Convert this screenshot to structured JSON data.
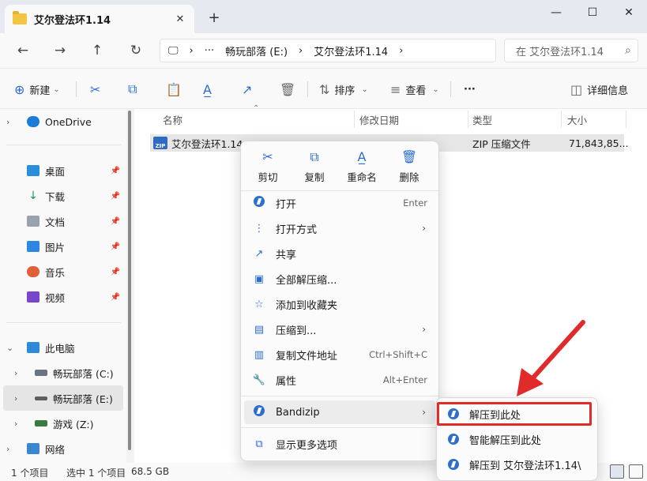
{
  "window": {
    "tab_title": "艾尔登法环1.14",
    "tab_close": "✕",
    "new_tab": "+",
    "minimize": "—",
    "maximize": "☐",
    "close": "✕"
  },
  "nav": {
    "back": "←",
    "forward": "→",
    "up": "↑",
    "refresh": "↻"
  },
  "address": {
    "computer_icon": "🖵",
    "sep1": "›",
    "more": "···",
    "crumb1": "畅玩部落 (E:)",
    "sep2": "›",
    "crumb2": "艾尔登法环1.14",
    "sep3": "›"
  },
  "search": {
    "placeholder": "在 艾尔登法环1.14",
    "icon": "⌕"
  },
  "toolbar": {
    "new_icon": "⊕",
    "new_label": "新建",
    "new_arrow": "⌄",
    "cut_icon": "✂",
    "copy_icon": "⧉",
    "paste_icon": "📋",
    "rename_icon": "A̲",
    "share_icon": "↗",
    "delete_icon": "🗑",
    "sort_icon": "⇅",
    "sort_label": "排序",
    "sort_arrow": "⌄",
    "view_icon": "≡",
    "view_label": "查看",
    "view_arrow": "⌄",
    "more": "···",
    "details_icon": "◫",
    "details_label": "详细信息"
  },
  "sidebar": {
    "onedrive": "OneDrive",
    "desktop": "桌面",
    "downloads": "下载",
    "documents": "文档",
    "pictures": "图片",
    "music": "音乐",
    "videos": "视频",
    "thispc": "此电脑",
    "drive_c": "畅玩部落 (C:)",
    "drive_e": "畅玩部落 (E:)",
    "drive_z": "游戏 (Z:)",
    "network": "网络",
    "pin": "📌",
    "chev_right": "›",
    "chev_down": "⌄"
  },
  "columns": {
    "name": "名称",
    "modified": "修改日期",
    "type": "类型",
    "size": "大小"
  },
  "file": {
    "icon_text": "ZIP",
    "name": "艾尔登法环1.14",
    "type": "ZIP 压缩文件",
    "size": "71,843,85..."
  },
  "status": {
    "count": "1 个项目",
    "selected": "选中 1 个项目",
    "size": "68.5 GB"
  },
  "context_menu": {
    "quick": [
      {
        "icon": "✂",
        "label": "剪切"
      },
      {
        "icon": "⧉",
        "label": "复制"
      },
      {
        "icon": "A̲",
        "label": "重命名"
      },
      {
        "icon": "🗑",
        "label": "删除"
      }
    ],
    "open": "打开",
    "open_shortcut": "Enter",
    "open_with": "打开方式",
    "share": "共享",
    "extract_all": "全部解压缩...",
    "add_favorites": "添加到收藏夹",
    "compress_to": "压缩到...",
    "copy_path": "复制文件地址",
    "copy_path_shortcut": "Ctrl+Shift+C",
    "properties": "属性",
    "properties_shortcut": "Alt+Enter",
    "bandizip": "Bandizip",
    "more_options": "显示更多选项",
    "arrow": "›"
  },
  "submenu": {
    "extract_here": "解压到此处",
    "smart_extract": "智能解压到此处",
    "extract_to": "解压到 艾尔登法环1.14\\"
  },
  "colors": {
    "highlight_box": "#e12a2a",
    "accent": "#2b6ccf"
  }
}
